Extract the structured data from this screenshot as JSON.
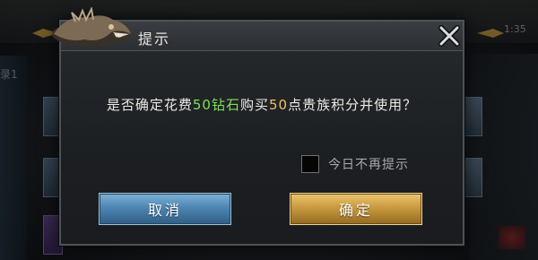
{
  "dialog": {
    "title": "提示",
    "message": {
      "prefix": "是否确定花费",
      "cost": "50钻石",
      "middle": "购买",
      "amount": "50",
      "suffix": "点贵族积分并使用？"
    },
    "remember_label": "今日不再提示",
    "remember_checked": false,
    "cancel_label": "取消",
    "confirm_label": "确定"
  },
  "background": {
    "clock": "1:35",
    "side_label": "录1"
  },
  "colors": {
    "highlight_green": "#7ee05a",
    "highlight_gold": "#f0c264",
    "cancel_button": "#4e86b2",
    "confirm_button": "#c99a3f"
  }
}
